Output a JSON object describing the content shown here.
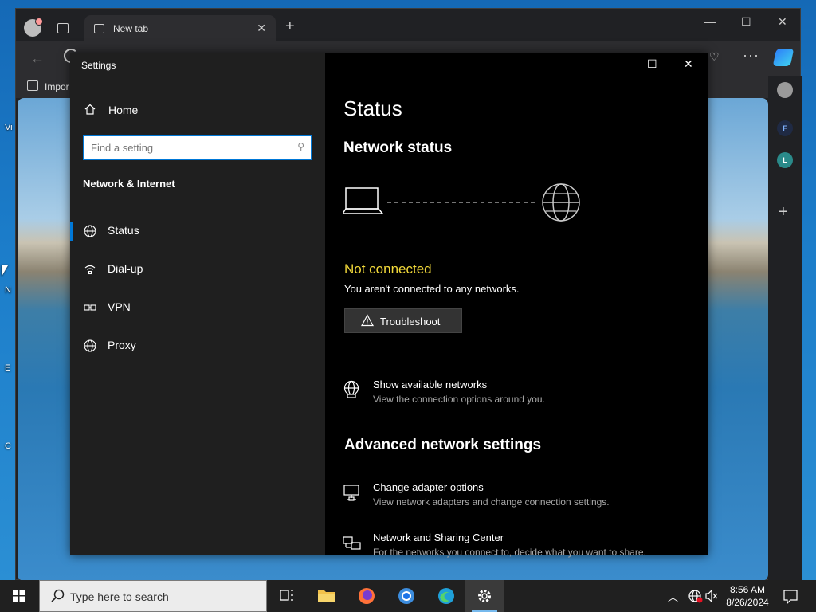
{
  "browser": {
    "tab_title": "New tab",
    "favorite_label": "Impor",
    "sidebar_letters": [
      "F",
      "L"
    ]
  },
  "desktop": {
    "icon_labels": [
      "Vi",
      "N",
      "E",
      "C"
    ]
  },
  "settings": {
    "window_title": "Settings",
    "home_label": "Home",
    "search_placeholder": "Find a setting",
    "section_title": "Network & Internet",
    "nav_items": [
      {
        "label": "Status",
        "icon": "globe-icon",
        "active": true
      },
      {
        "label": "Dial-up",
        "icon": "dialup-icon",
        "active": false
      },
      {
        "label": "VPN",
        "icon": "vpn-icon",
        "active": false
      },
      {
        "label": "Proxy",
        "icon": "globe-icon",
        "active": false
      }
    ],
    "main": {
      "page_title": "Status",
      "network_status_heading": "Network status",
      "connection_state": "Not connected",
      "connection_desc": "You aren't connected to any networks.",
      "troubleshoot_label": "Troubleshoot",
      "show_networks_title": "Show available networks",
      "show_networks_sub": "View the connection options around you.",
      "advanced_heading": "Advanced network settings",
      "adapter_title": "Change adapter options",
      "adapter_sub": "View network adapters and change connection settings.",
      "sharing_title": "Network and Sharing Center",
      "sharing_sub": "For the networks you connect to, decide what you want to share."
    },
    "colors": {
      "accent": "#0078d7",
      "warning_text": "#f2d93a"
    }
  },
  "taskbar": {
    "search_placeholder": "Type here to search",
    "time": "8:56 AM",
    "date": "8/26/2024"
  }
}
